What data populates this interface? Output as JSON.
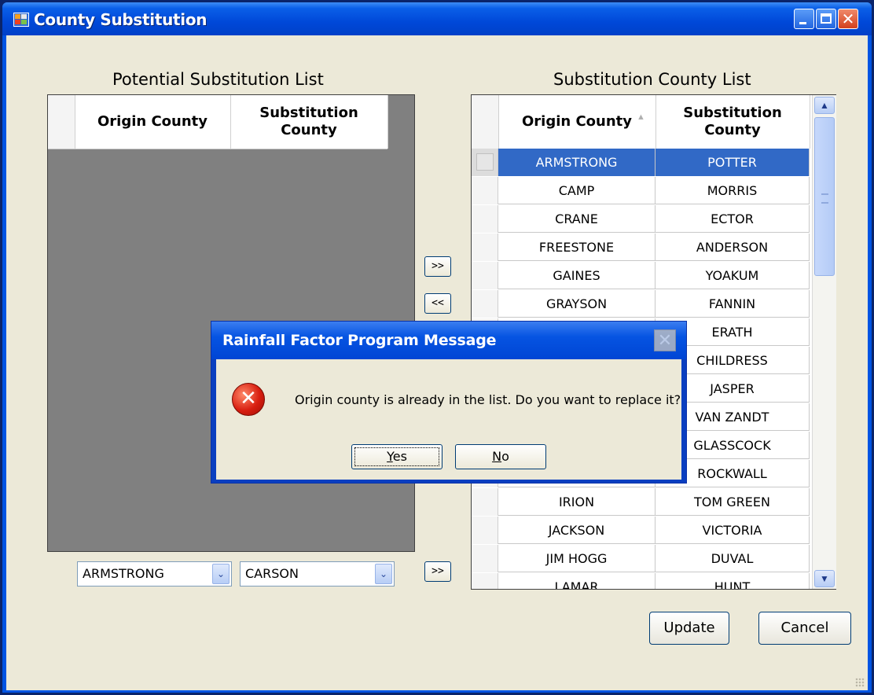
{
  "window": {
    "title": "County Substitution",
    "controls": {
      "minimize": "_",
      "maximize": "□",
      "close": "✕"
    }
  },
  "left_panel": {
    "title": "Potential Substitution List",
    "columns": [
      "Origin County",
      "Substitution County"
    ]
  },
  "right_panel": {
    "title": "Substitution County List",
    "columns": [
      "Origin County",
      "Substitution County"
    ],
    "sort_indicator": "▲",
    "rows": [
      {
        "origin": "ARMSTRONG",
        "sub": "POTTER"
      },
      {
        "origin": "CAMP",
        "sub": "MORRIS"
      },
      {
        "origin": "CRANE",
        "sub": "ECTOR"
      },
      {
        "origin": "FREESTONE",
        "sub": "ANDERSON"
      },
      {
        "origin": "GAINES",
        "sub": "YOAKUM"
      },
      {
        "origin": "GRAYSON",
        "sub": "FANNIN"
      },
      {
        "origin": "",
        "sub": "ERATH"
      },
      {
        "origin": "",
        "sub": "CHILDRESS"
      },
      {
        "origin": "",
        "sub": "JASPER"
      },
      {
        "origin": "",
        "sub": "VAN ZANDT"
      },
      {
        "origin": "",
        "sub": "GLASSCOCK"
      },
      {
        "origin": "",
        "sub": "ROCKWALL"
      },
      {
        "origin": "IRION",
        "sub": "TOM GREEN"
      },
      {
        "origin": "JACKSON",
        "sub": "VICTORIA"
      },
      {
        "origin": "JIM HOGG",
        "sub": "DUVAL"
      },
      {
        "origin": "LAMAR",
        "sub": "HUNT"
      }
    ],
    "selected_index": 0
  },
  "transfer": {
    "add_label": ">>",
    "remove_label": "<<",
    "add_combo_label": ">>"
  },
  "combos": {
    "origin_value": "ARMSTRONG",
    "substitution_value": "CARSON",
    "dropdown_glyph": "⌄"
  },
  "buttons": {
    "update": "Update",
    "cancel": "Cancel"
  },
  "dialog": {
    "title": "Rainfall Factor Program Message",
    "message": "Origin county is already in the list. Do you want to replace it?",
    "icon": "error-icon",
    "icon_glyph": "✕",
    "yes_mnemonic": "Y",
    "yes_rest": "es",
    "no_mnemonic": "N",
    "no_rest": "o",
    "close_glyph": "✕"
  },
  "colors": {
    "selection": "#3169c6",
    "titlebar": "#0054e3",
    "dialog_bg": "#ece9d8"
  }
}
